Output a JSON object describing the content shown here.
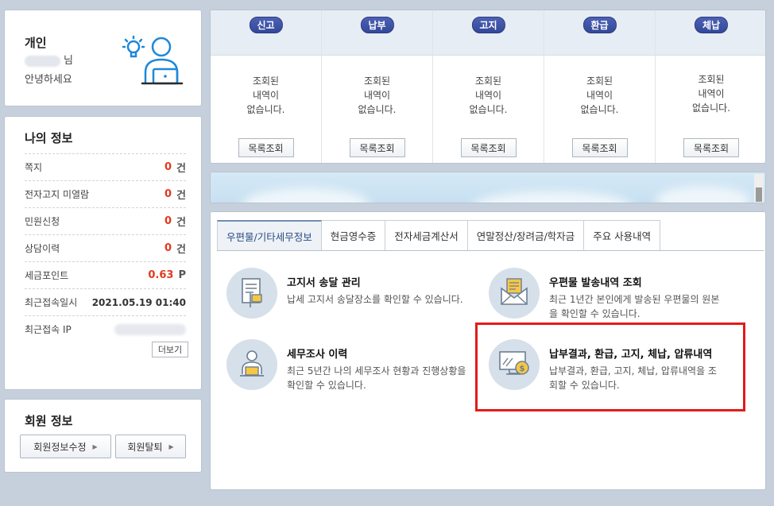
{
  "greeting": {
    "type": "개인",
    "suffix": "님",
    "hello": "안녕하세요"
  },
  "my_info": {
    "title": "나의 정보",
    "rows": [
      {
        "label": "쪽지",
        "value": "0",
        "unit": "건"
      },
      {
        "label": "전자고지 미열람",
        "value": "0",
        "unit": "건"
      },
      {
        "label": "민원신청",
        "value": "0",
        "unit": "건"
      },
      {
        "label": "상담이력",
        "value": "0",
        "unit": "건"
      },
      {
        "label": "세금포인트",
        "value": "0.63",
        "unit": "P"
      }
    ],
    "last_login_label": "최근접속일시",
    "last_login_value": "2021.05.19 01:40",
    "last_ip_label": "최근접속 IP",
    "more_label": "더보기"
  },
  "member_info": {
    "title": "회원 정보",
    "edit_label": "회원정보수정",
    "withdraw_label": "회원탈퇴"
  },
  "status_columns": [
    {
      "badge": "신고",
      "message_lines": [
        "조회된",
        "내역이",
        "없습니다."
      ],
      "button": "목록조회"
    },
    {
      "badge": "납부",
      "message_lines": [
        "조회된",
        "내역이",
        "없습니다."
      ],
      "button": "목록조회"
    },
    {
      "badge": "고지",
      "message_lines": [
        "조회된",
        "내역이",
        "없습니다."
      ],
      "button": "목록조회"
    },
    {
      "badge": "환급",
      "message_lines": [
        "조회된",
        "내역이",
        "없습니다."
      ],
      "button": "목록조회"
    },
    {
      "badge": "체납",
      "message_lines": [
        "조회된",
        "내역이",
        "없습니다."
      ],
      "button": "목록조회"
    }
  ],
  "tabs": [
    {
      "label": "우편물/기타세무정보",
      "active": true
    },
    {
      "label": "현금영수증",
      "active": false
    },
    {
      "label": "전자세금계산서",
      "active": false
    },
    {
      "label": "연말정산/장려금/학자금",
      "active": false
    },
    {
      "label": "주요 사용내역",
      "active": false
    }
  ],
  "services": [
    {
      "title": "고지서 송달 관리",
      "description": "납세 고지서 송달장소를 확인할 수 있습니다.",
      "icon": "document-flag-icon"
    },
    {
      "title": "우편물 발송내역 조회",
      "description": "최근 1년간 본인에게 발송된 우편물의 원본을 확인할 수 있습니다.",
      "icon": "envelope-icon"
    },
    {
      "title": "세무조사 이력",
      "description": "최근 5년간 나의 세무조사 현황과 진행상황을 확인할 수 있습니다.",
      "icon": "person-laptop-icon"
    },
    {
      "title": "납부결과, 환급, 고지, 체납, 압류내역",
      "description": "납부결과, 환급, 고지, 체납, 압류내역을 조회할 수 있습니다.",
      "icon": "monitor-coin-icon"
    }
  ],
  "colors": {
    "accent_red": "#e03a1e",
    "badge_blue": "#3b4fa3",
    "icon_blue": "#1e88d8",
    "highlight_red": "#e21b1b"
  }
}
